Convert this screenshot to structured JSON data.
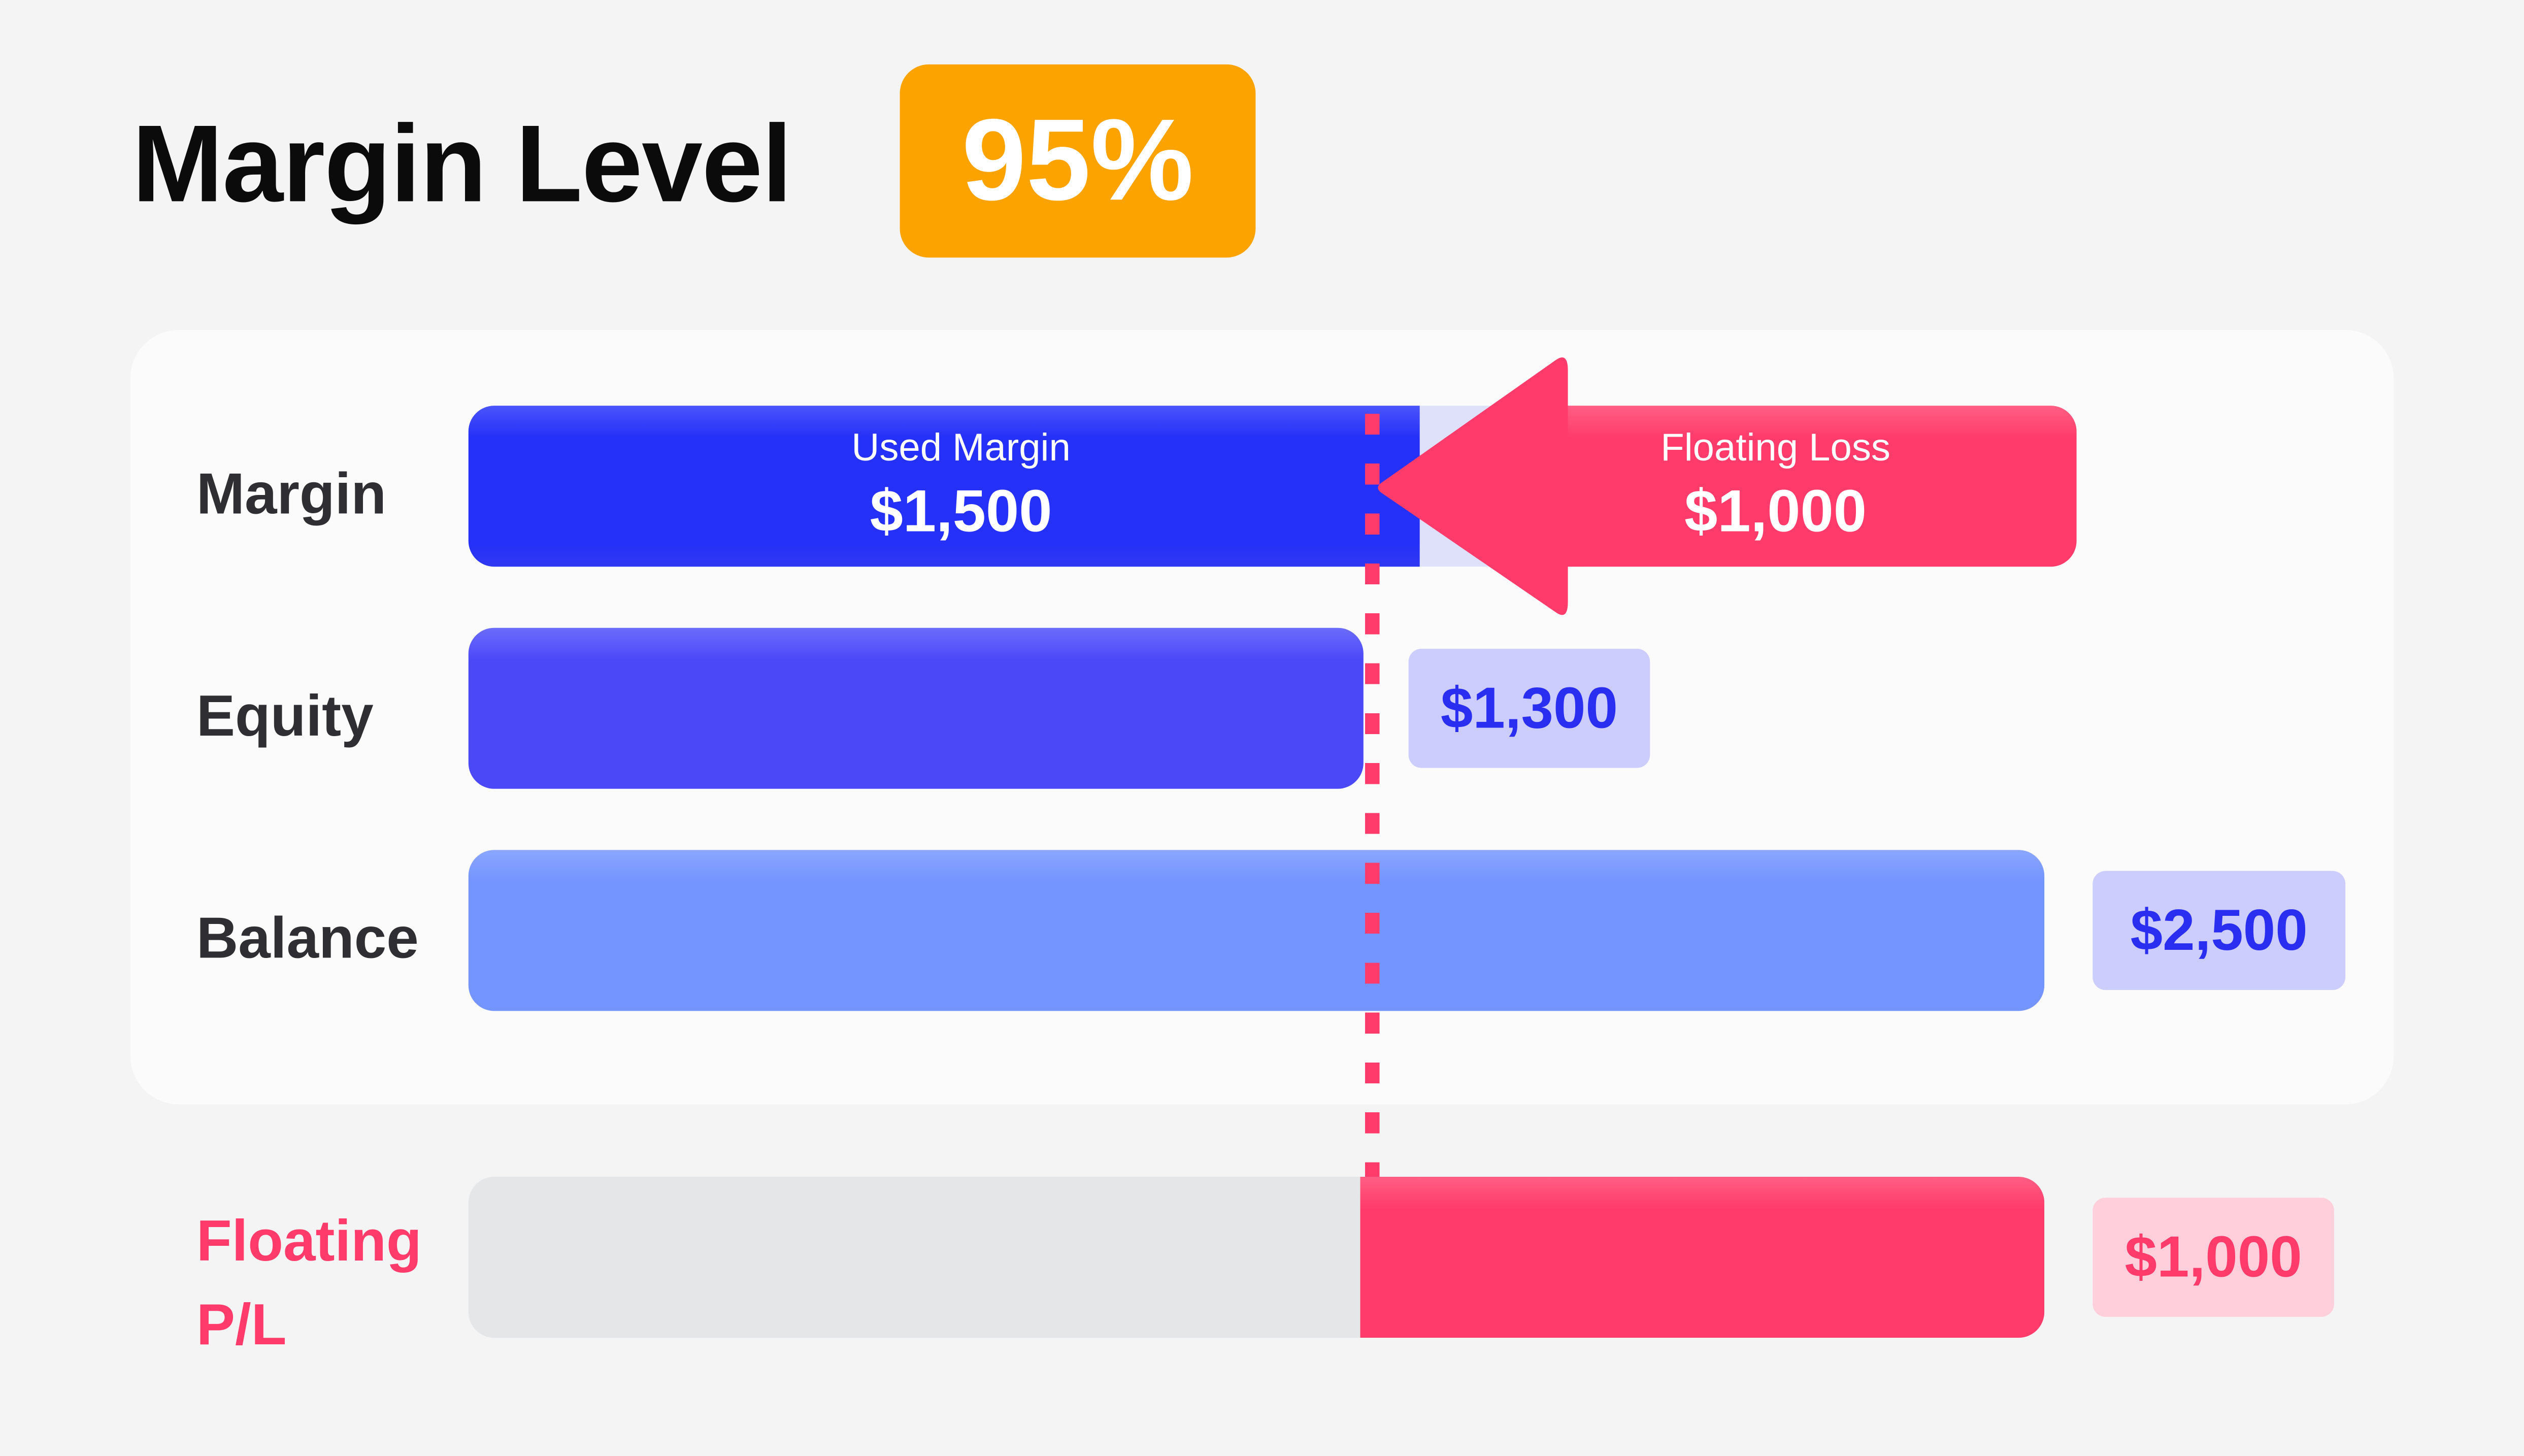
{
  "header": {
    "title": "Margin Level",
    "margin_level": "95%"
  },
  "rows": {
    "margin": {
      "label": "Margin",
      "used_label": "Used Margin",
      "used_value": "$1,500",
      "loss_label": "Floating Loss",
      "loss_value": "$1,000"
    },
    "equity": {
      "label": "Equity",
      "value": "$1,300"
    },
    "balance": {
      "label": "Balance",
      "value": "$2,500"
    },
    "floating": {
      "label_line1": "Floating",
      "label_line2": "P/L",
      "value": "$1,000"
    }
  },
  "colors": {
    "accent_orange": "#fca300",
    "used_margin": "#2530f8",
    "equity": "#4b48f8",
    "balance": "#7494ff",
    "loss": "#ff3b6b"
  }
}
